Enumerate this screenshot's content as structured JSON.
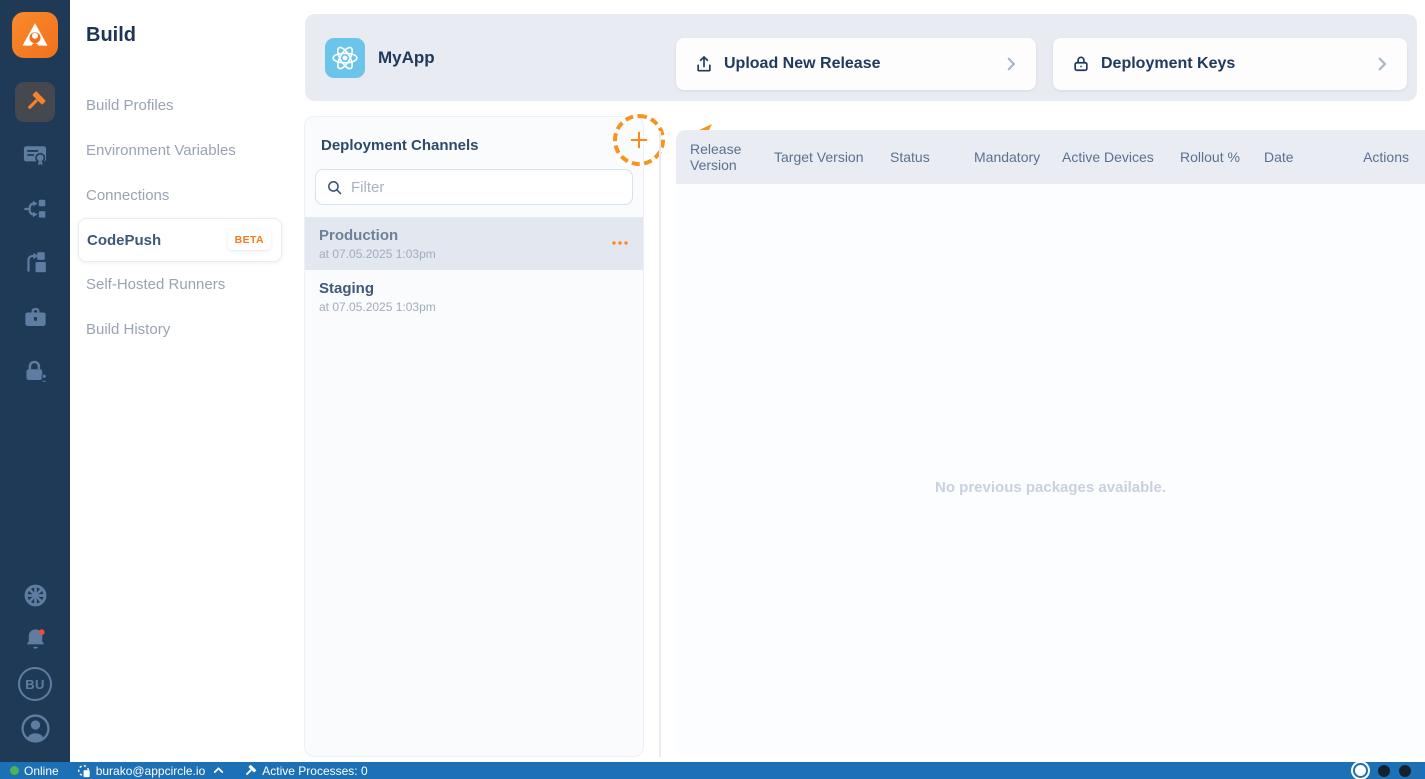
{
  "colors": {
    "accent_orange": "#F68B1F",
    "annotation_orange": "#F6941F",
    "rail_bg": "#1E3A57",
    "rail_icon": "#5F7CA1",
    "statusbar_bg": "#1C70B5",
    "online_green": "#4FB254",
    "notification_red": "#F0483E",
    "react_icon_bg": "#6BC5EA",
    "selected_channel_bg": "#E3E8F0"
  },
  "rail": {
    "org_initials": "BU"
  },
  "sidebar": {
    "title": "Build",
    "items": [
      {
        "label": "Build Profiles"
      },
      {
        "label": "Environment Variables"
      },
      {
        "label": "Connections"
      },
      {
        "label": "CodePush",
        "badge": "BETA",
        "active": true
      },
      {
        "label": "Self-Hosted Runners"
      },
      {
        "label": "Build History"
      }
    ]
  },
  "header": {
    "app_name": "MyApp",
    "upload_button": "Upload New Release",
    "keys_button": "Deployment Keys"
  },
  "channels": {
    "title": "Deployment Channels",
    "filter_placeholder": "Filter",
    "items": [
      {
        "name": "Production",
        "date": "at 07.05.2025 1:03pm",
        "selected": true
      },
      {
        "name": "Staging",
        "date": "at 07.05.2025 1:03pm",
        "selected": false
      }
    ]
  },
  "table": {
    "columns": [
      "Release Version",
      "Target Version",
      "Status",
      "Mandatory",
      "Active Devices",
      "Rollout %",
      "Date",
      "Actions"
    ],
    "empty_message": "No previous packages available."
  },
  "statusbar": {
    "online_label": "Online",
    "account_email": "burako@appcircle.io",
    "active_processes": "Active Processes: 0"
  }
}
